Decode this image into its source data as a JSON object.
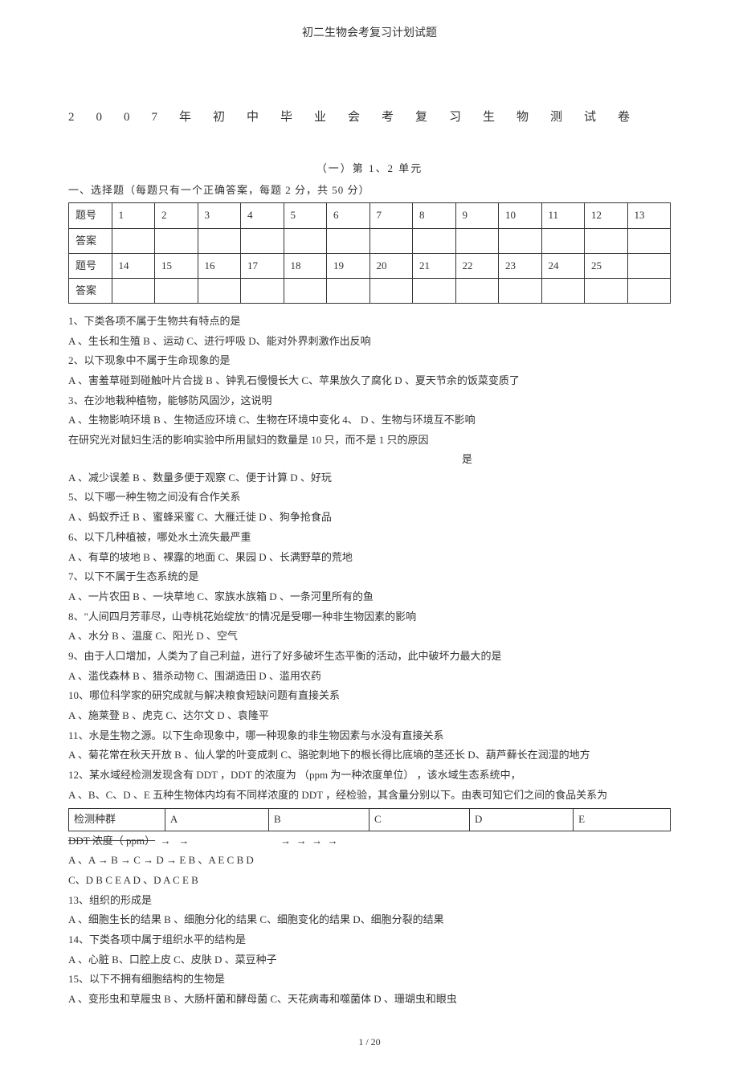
{
  "doc_title": "初二生物会考复习计划试题",
  "main_title": "2007年初中毕业会考复习生物测试卷",
  "subtitle": "（一）第  1、2 单元",
  "section_header": "一、选择题（每题只有一个正确答案，每题        2 分，共  50 分）",
  "table": {
    "row1_label": "题号",
    "row1_nums": [
      "1",
      "2",
      "3",
      "4",
      "5",
      "6",
      "7",
      "8",
      "9",
      "10",
      "11",
      "12",
      "13"
    ],
    "row2_label": "答案",
    "row3_label": "题号",
    "row3_nums": [
      "14",
      "15",
      "16",
      "17",
      "18",
      "19",
      "20",
      "21",
      "22",
      "23",
      "24",
      "25",
      ""
    ],
    "row4_label": "答案"
  },
  "q1": {
    "text": "1、下类各项不属于生物共有特点的是",
    "opts": "A 、生长和生殖   B 、运动  C、进行呼吸   D、能对外界刺激作出反响"
  },
  "q2": {
    "text": "2、以下现象中不属于生命现象的是",
    "opts": "A 、害羞草碰到碰触叶片合拢     B 、钟乳石慢慢长大    C、苹果放久了腐化    D 、夏天节余的饭菜变质了"
  },
  "q3": {
    "text": "3、在沙地栽种植物，能够防风固沙，这说明",
    "opts": "A 、生物影响环境 B 、生物适应环境 C、生物在环境中变化 4、   D 、生物与环境互不影响"
  },
  "q4": {
    "text": "在研究光对鼠妇生活的影响实验中所用鼠妇的数量是           10 只，而不是    1 只的原因",
    "reason": "是",
    "opts": "A 、减少误差   B 、数量多便于观察    C、便于计算   D 、好玩"
  },
  "q5": {
    "text": "5、以下哪一种生物之间没有合作关系",
    "opts": "A 、蚂蚁乔迁   B 、蜜蜂采蜜   C、大雁迁徙   D 、狗争抢食品"
  },
  "q6": {
    "text": "6、以下几种植被，哪处水土流失最严重",
    "opts": "A 、有草的坡地   B 、裸露的地面   C、果园   D 、长满野草的荒地"
  },
  "q7": {
    "text": "7、以下不属于生态系统的是",
    "opts": "A 、一片农田   B 、一块草地   C、家族水族箱   D 、一条河里所有的鱼"
  },
  "q8": {
    "text": "8、\"人间四月芳菲尽，山寺桃花始绽放\"的情况是受哪一种非生物因素的影响",
    "opts": "A 、水分  B 、温度  C、阳光  D 、空气"
  },
  "q9": {
    "text": "9、由于人口增加，人类为了自己利益，进行了好多破坏生态平衡的活动，此中破坏力最大的是",
    "opts": "A 、滥伐森林   B 、猎杀动物   C、围湖造田   D 、滥用农药"
  },
  "q10": {
    "text": "10、哪位科学家的研究成就与解决粮食短缺问题有直接关系",
    "opts": "A 、施莱登  B 、虎克  C、达尔文   D 、袁隆平"
  },
  "q11": {
    "text": "11、水是生物之源。以下生命现象中，哪一种现象的非生物因素与水没有直接关系",
    "opts": "A 、菊花常在秋天开放    B 、仙人掌的叶变成刺    C、骆驼刺地下的根长得比底墒的茎还长       D、葫芦藓长在润湿的地方"
  },
  "q12": {
    "text1": "12、某水域经检测发现含有    DDT ，DDT  的浓度为  （ppm 为一种浓度单位）  ，该水域生态系统中，",
    "text2": "A 、B、C、D 、E 五种生物体内均有不同样浓度的 DDT ，经检验，其含量分别以下。由表可知它们之间的食品关系为",
    "table_header": [
      "检测种群",
      "A",
      "B",
      "C",
      "D",
      "E"
    ],
    "ddt_row": "DDT 浓度（ ppm）",
    "opt_line1": "A 、A → B → C → D → E           B 、A     E    C    B    D",
    "opt_line2": "C、D     B     C     E     A          D 、D    A    C    E    B"
  },
  "q13": {
    "text": "13、组织的形成是",
    "opts": "A 、细胞生长的结果   B 、细胞分化的结果   C、细胞变化的结果   D、细胞分裂的结果"
  },
  "q14": {
    "text": "14、下类各项中属于组织水平的结构是",
    "opts": "A 、心脏  B、口腔上皮   C、皮肤   D 、菜豆种子"
  },
  "q15": {
    "text": "15、以下不拥有细胞结构的生物是",
    "opts": "A 、变形虫和草履虫   B 、大肠杆菌和酵母菌    C、天花病毒和噬菌体    D 、珊瑚虫和眼虫"
  },
  "footer": "1 / 20"
}
